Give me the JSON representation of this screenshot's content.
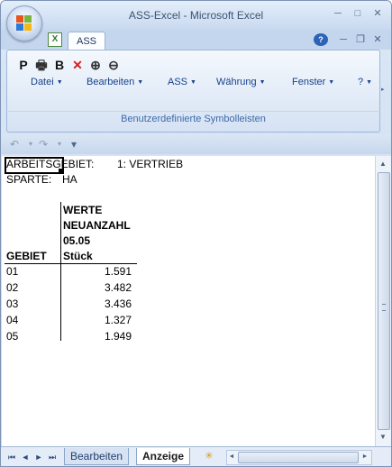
{
  "window": {
    "title": "ASS-Excel - Microsoft Excel",
    "min_glyph": "─",
    "max_glyph": "□",
    "close_glyph": "✕"
  },
  "doc": {
    "icon_letter": "X",
    "tab_label": "ASS",
    "help_glyph": "?",
    "min_glyph": "─",
    "restore_glyph": "❐",
    "close_glyph": "✕"
  },
  "ribbon": {
    "tools": [
      {
        "name": "p-icon",
        "glyph": "P",
        "color": "#111111"
      },
      {
        "name": "print-icon",
        "glyph": "🖶",
        "color": "#333333"
      },
      {
        "name": "b-icon",
        "glyph": "B",
        "color": "#111111"
      },
      {
        "name": "delete-icon",
        "glyph": "✕",
        "color": "#d81e1e"
      },
      {
        "name": "zoom-in-icon",
        "glyph": "⊕",
        "color": "#333333"
      },
      {
        "name": "zoom-out-icon",
        "glyph": "⊖",
        "color": "#333333"
      }
    ],
    "menus": [
      {
        "label": "Datei",
        "arrow": "▼"
      },
      {
        "label": "Bearbeiten",
        "arrow": "▼"
      },
      {
        "label": "ASS",
        "arrow": "▼"
      },
      {
        "label": "Währung",
        "arrow": "▼"
      },
      {
        "label": "Fenster",
        "arrow": "▼"
      },
      {
        "label": "?",
        "arrow": "▼"
      }
    ],
    "group_label": "Benutzerdefinierte Symbolleisten",
    "side_arrow": "▸"
  },
  "qat": {
    "undo_glyph": "↶",
    "redo_glyph": "↷",
    "customize_glyph": "▾"
  },
  "sheet": {
    "header_line1_key": "ARBEITSGEBIET:",
    "header_line1_value": "1: VERTRIEB",
    "header_line2_key": "SPARTE:",
    "header_line2_value": "HA",
    "col_header_lines": [
      "WERTE",
      "NEUANZAHL",
      "05.05",
      "Stück"
    ],
    "row_header": "GEBIET",
    "rows": [
      {
        "gebiet": "01",
        "wert": "1.591"
      },
      {
        "gebiet": "02",
        "wert": "3.482"
      },
      {
        "gebiet": "03",
        "wert": "3.436"
      },
      {
        "gebiet": "04",
        "wert": "1.327"
      },
      {
        "gebiet": "05",
        "wert": "1.949"
      }
    ]
  },
  "scroll": {
    "up": "▲",
    "down": "▼",
    "left": "◄",
    "right": "►"
  },
  "bottom": {
    "nav": [
      "⏮",
      "◄",
      "►",
      "⏭"
    ],
    "tabs": [
      {
        "label": "Bearbeiten",
        "active": false
      },
      {
        "label": "Anzeige",
        "active": true
      }
    ],
    "new_tab_glyph": "✳"
  }
}
